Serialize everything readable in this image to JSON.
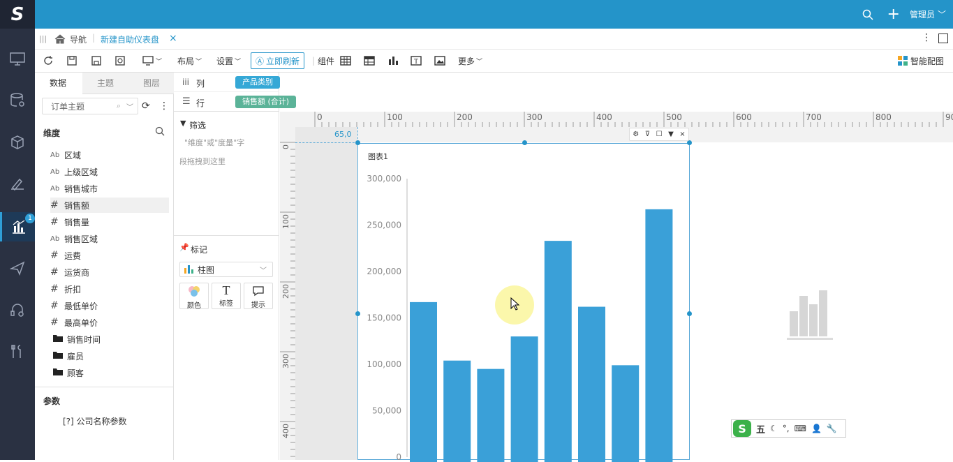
{
  "app": {
    "logo_letter": "S"
  },
  "leftnav": {
    "badge": "1",
    "items": [
      "monitor-icon",
      "database-gear-icon",
      "cube-icon",
      "ruler-pencil-icon",
      "bar-chart-icon",
      "send-icon",
      "headset-icon",
      "tools-icon"
    ]
  },
  "header": {
    "user": "管理员"
  },
  "tabs": {
    "nav_label": "导航",
    "active_tab": "新建自助仪表盘",
    "close": "×"
  },
  "toolbar": {
    "layout": "布局",
    "settings": "设置",
    "refresh_now": "立即刷新",
    "components": "组件",
    "more": "更多",
    "smart_chart": "智能配图"
  },
  "datapanel": {
    "tabs": [
      "数据",
      "主题",
      "图层"
    ],
    "topic_placeholder": "订单主题",
    "dimension_title": "维度",
    "fields": [
      {
        "type": "Ab",
        "label": "区域"
      },
      {
        "type": "Ab",
        "label": "上级区域"
      },
      {
        "type": "Ab",
        "label": "销售城市"
      },
      {
        "type": "#",
        "label": "销售额"
      },
      {
        "type": "#",
        "label": "销售量"
      },
      {
        "type": "Ab",
        "label": "销售区域"
      },
      {
        "type": "#",
        "label": "运费"
      },
      {
        "type": "#",
        "label": "运货商"
      },
      {
        "type": "#",
        "label": "折扣"
      },
      {
        "type": "#",
        "label": "最低单价"
      },
      {
        "type": "#",
        "label": "最高单价"
      }
    ],
    "folders": [
      "销售时间",
      "雇员",
      "顾客"
    ],
    "params_title": "参数",
    "param_item": "[?] 公司名称参数"
  },
  "shelf": {
    "col_label": "列",
    "col_pill": "产品类别",
    "row_label": "行",
    "row_pill": "销售额 (合计)"
  },
  "filter": {
    "title": "筛选",
    "hint1": "\"维度\"或\"度量\"字",
    "hint2": "段拖拽到这里"
  },
  "marks": {
    "title": "标记",
    "chart_type": "柱图",
    "buttons": [
      "颜色",
      "标签",
      "提示"
    ]
  },
  "ruler": {
    "h_ticks": [
      "0",
      "100",
      "200",
      "300",
      "400",
      "500",
      "600",
      "700",
      "800",
      "90"
    ],
    "v_ticks": [
      "0",
      "100",
      "200",
      "300",
      "400"
    ],
    "position": "65,0"
  },
  "widget": {
    "title": "图表1"
  },
  "colors": {
    "topbar": "#2494c9",
    "nav": "#2a3142",
    "bar": "#3aa0d8",
    "accent": "#2494c9",
    "col_pill": "#35a8d6",
    "row_pill": "#5bb398"
  },
  "chart_data": {
    "type": "bar",
    "categories": [
      "",
      "",
      "",
      "",
      "",
      "",
      "",
      ""
    ],
    "values": [
      167000,
      104000,
      95000,
      130000,
      233000,
      162000,
      99000,
      267000
    ],
    "ylim": [
      0,
      300000
    ],
    "yticks": [
      "0",
      "50,000",
      "100,000",
      "150,000",
      "200,000",
      "250,000",
      "300,000"
    ]
  },
  "ime": {
    "label": "五"
  }
}
